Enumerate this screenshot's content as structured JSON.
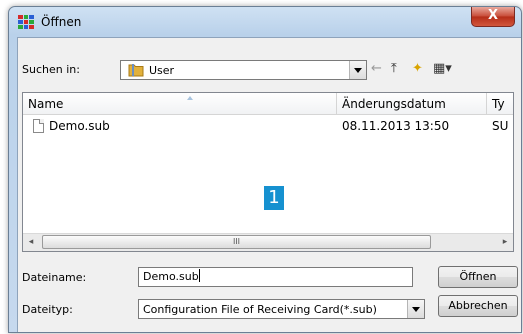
{
  "window": {
    "title": "Öffnen",
    "close_glyph": "X"
  },
  "lookin": {
    "label": "Suchen in:",
    "value": "User"
  },
  "toolbar": {
    "back_glyph": "←",
    "up_glyph": "⤒",
    "newfolder_glyph": "✦",
    "view_glyph": "▦▾"
  },
  "columns": [
    {
      "label": "Name"
    },
    {
      "label": "Änderungsdatum"
    },
    {
      "label": "Ty"
    }
  ],
  "files": [
    {
      "name": "Demo.sub",
      "date": "08.11.2013 13:50",
      "type": "SU"
    }
  ],
  "scrollbar": {
    "left": "◂",
    "thumb": "III",
    "right": "▸"
  },
  "badge": "1",
  "filename": {
    "label": "Dateiname:",
    "value": "Demo.sub"
  },
  "filetype": {
    "label": "Dateityp:",
    "value": "Configuration File of Receiving Card(*.sub)"
  },
  "buttons": {
    "open": "Öffnen",
    "cancel": "Abbrechen"
  },
  "colors": {
    "badge": "#1691d0",
    "close": "#c74a36",
    "folder": "#e2b13c"
  }
}
